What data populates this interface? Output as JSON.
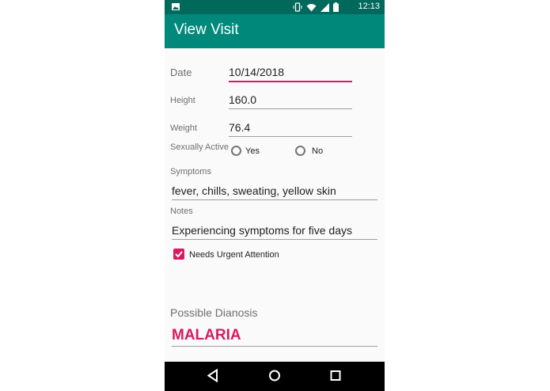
{
  "status_bar": {
    "time": "12:13"
  },
  "app_bar": {
    "title": "View Visit"
  },
  "form": {
    "date": {
      "label": "Date",
      "value": "10/14/2018"
    },
    "height": {
      "label": "Height",
      "value": "160.0"
    },
    "weight": {
      "label": "Weight",
      "value": "76.4"
    },
    "sexually_active": {
      "label": "Sexually Active",
      "options": [
        "Yes",
        "No"
      ]
    },
    "symptoms": {
      "label": "Symptoms",
      "value": "fever, chills, sweating, yellow skin"
    },
    "notes": {
      "label": "Notes",
      "value": "Experiencing symptoms for five days"
    },
    "urgent": {
      "label": "Needs Urgent Attention",
      "checked": true
    }
  },
  "diagnosis": {
    "label": "Possible Dianosis",
    "value": "MALARIA"
  },
  "colors": {
    "status_bar": "#00695c",
    "app_bar": "#00897b",
    "accent": "#d81b60"
  }
}
